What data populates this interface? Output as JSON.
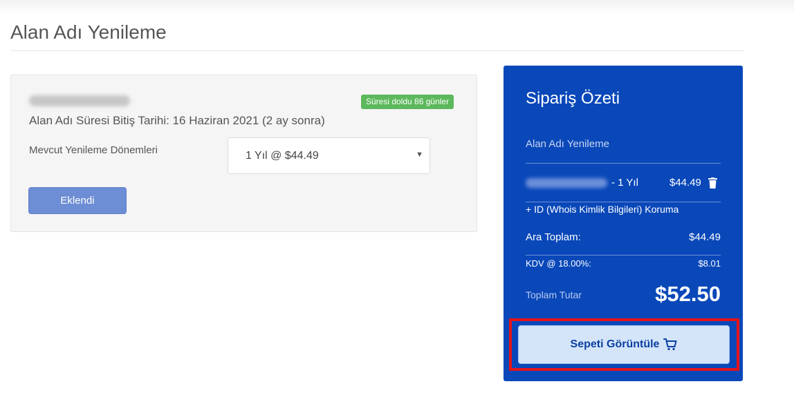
{
  "page": {
    "title": "Alan Adı Yenileme"
  },
  "domain_panel": {
    "status_badge": "Süresi doldu 86 günler",
    "expiry_text": "Alan Adı Süresi Bitiş Tarihi: 16 Haziran 2021 (2 ay sonra)",
    "period_label": "Mevcut Yenileme Dönemleri",
    "period_selected": "1 Yıl @ $44.49",
    "added_button": "Eklendi"
  },
  "summary": {
    "title": "Sipariş Özeti",
    "section": "Alan Adı Yenileme",
    "item_period": "- 1 Yıl",
    "item_price": "$44.49",
    "addon": "+ ID (Whois Kimlik Bilgileri) Koruma",
    "subtotal_label": "Ara Toplam:",
    "subtotal_value": "$44.49",
    "tax_label": "KDV @ 18.00%:",
    "tax_value": "$8.01",
    "total_label": "Toplam Tutar",
    "total_value": "$52.50",
    "view_cart_button": "Sepeti Görüntüle"
  },
  "colors": {
    "summary_bg": "#0a48b9",
    "badge_green": "#5cb85c",
    "button_blue": "#6d8dd4",
    "highlight_red": "#e3141b",
    "cart_button_bg": "#d4e5fa"
  },
  "icons": {
    "trash": "trash-icon",
    "cart": "cart-icon",
    "select_caret": "caret-down-icon"
  }
}
